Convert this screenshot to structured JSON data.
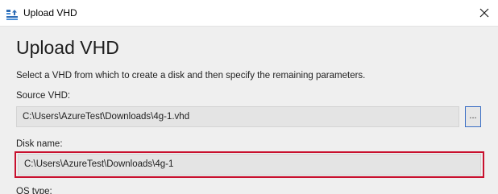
{
  "window": {
    "title": "Upload VHD",
    "title_icon": "upload-vhd-icon",
    "close_icon": "close-icon"
  },
  "main": {
    "heading": "Upload VHD",
    "description": "Select a VHD from which to create a disk and then specify the remaining parameters.",
    "source_vhd": {
      "label": "Source VHD:",
      "value": "C:\\Users\\AzureTest\\Downloads\\4g-1.vhd",
      "browse_label": "..."
    },
    "disk_name": {
      "label": "Disk name:",
      "value": "C:\\Users\\AzureTest\\Downloads\\4g-1",
      "highlight_color": "#c8102e"
    },
    "os_type": {
      "label": "OS type:"
    }
  },
  "colors": {
    "content_background": "#efefef",
    "field_background": "#e4e4e4",
    "browse_border": "#3b6fc5",
    "highlight": "#c8102e"
  }
}
